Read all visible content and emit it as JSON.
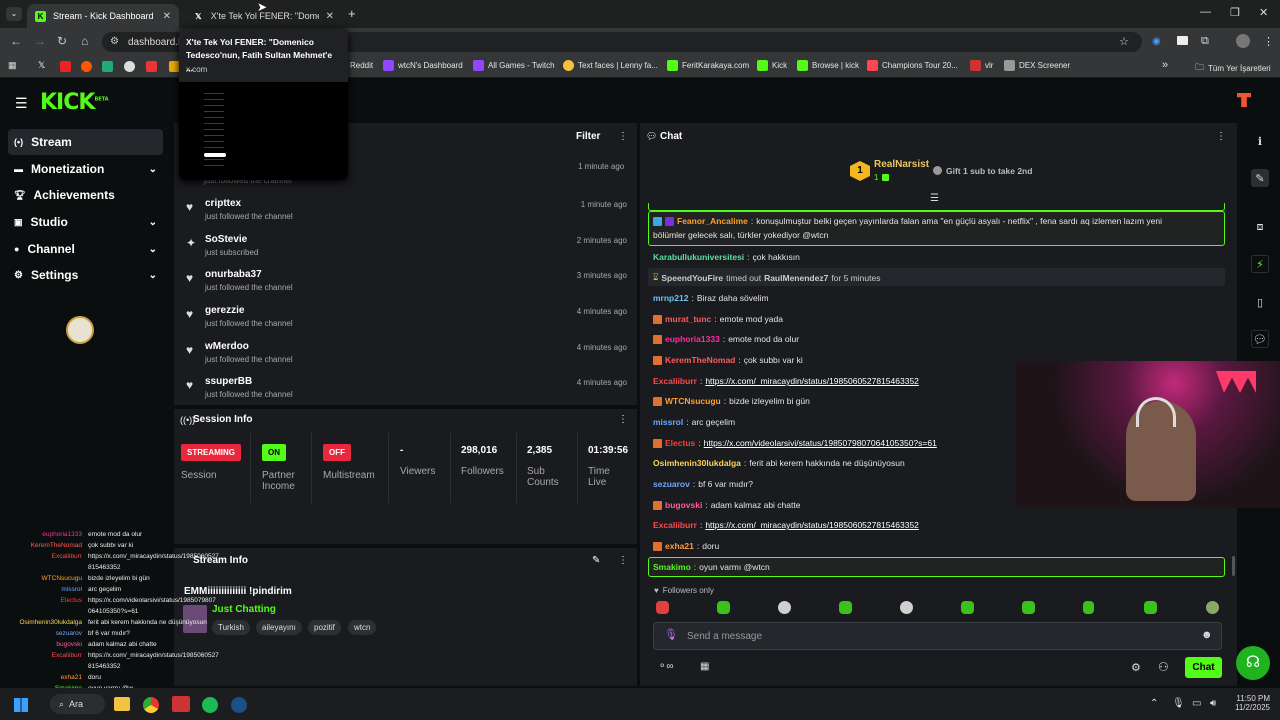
{
  "browser": {
    "tabs": [
      {
        "label": "Stream - Kick Dashboard",
        "close": "✕"
      },
      {
        "label": "X'te Tek Yol FENER: \"Domenico",
        "close": "✕"
      }
    ],
    "new_tab": "+",
    "url": "dashboard.k",
    "tooltip": {
      "title": "X'te Tek Yol FENER: \"Domenico Tedesco'nun, Fatih Sultan Mehmet'e ...",
      "site": "x.com"
    },
    "bookmarks": [
      "Reddit",
      "wtcN's Dashboard",
      "All Games - Twitch",
      "Text faces | Lenny fa...",
      "FeritKarakaya.com",
      "Kick",
      "Browse | kick",
      "Champions Tour 20...",
      "vlr",
      "DEX Screener"
    ],
    "bookmarks_more": "»",
    "all_bookmarks": "Tüm Yer İşaretleri",
    "colors": {
      "tabbar": "#1f2020",
      "toolbar": "#353637",
      "kick_green": "#53fc18"
    }
  },
  "app": {
    "logo": "KICK",
    "logo_beta": "BETA",
    "nav": [
      {
        "label": "Stream",
        "chev": ""
      },
      {
        "label": "Monetization",
        "chev": "⌄"
      },
      {
        "label": "Achievements",
        "chev": ""
      },
      {
        "label": "Studio",
        "chev": "⌄"
      },
      {
        "label": "Channel",
        "chev": "⌄"
      },
      {
        "label": "Settings",
        "chev": "⌄"
      }
    ]
  },
  "activity": {
    "filter": "Filter",
    "partial_sub": "just followed the channel",
    "events": [
      {
        "name": "cripttex",
        "action": "just followed the channel",
        "time": "1 minute ago",
        "icon": "heart-icon"
      },
      {
        "name": "SoStevie",
        "action": "just subscribed",
        "time": "2 minutes ago",
        "icon": "star-icon"
      },
      {
        "name": "onurbaba37",
        "action": "just followed the channel",
        "time": "3 minutes ago",
        "icon": "heart-icon"
      },
      {
        "name": "gerezzie",
        "action": "just followed the channel",
        "time": "4 minutes ago",
        "icon": "heart-icon"
      },
      {
        "name": "wMerdoo",
        "action": "just followed the channel",
        "time": "4 minutes ago",
        "icon": "heart-icon"
      },
      {
        "name": "ssuperBB",
        "action": "just followed the channel",
        "time": "4 minutes ago",
        "icon": "heart-icon"
      }
    ],
    "first_time": "1 minute ago"
  },
  "session": {
    "title": "Session Info",
    "items": [
      {
        "badge": "STREAMING",
        "label": "Session"
      },
      {
        "badge": "ON",
        "label": "Partner Income"
      },
      {
        "badge": "OFF",
        "label": "Multistream"
      }
    ],
    "stats": [
      {
        "value": "-",
        "label": "Viewers"
      },
      {
        "value": "298,016",
        "label": "Followers"
      },
      {
        "value": "2,385",
        "label": "Sub Counts"
      },
      {
        "value": "01:39:56",
        "label": "Time Live"
      }
    ]
  },
  "stream_info": {
    "title": "Stream Info",
    "stream_title": "EMMiiiiiiiiiiiiii !pindirim",
    "category": "Just Chatting",
    "tags": [
      "Turkish",
      "aileyayını",
      "pozitif",
      "wtcn"
    ]
  },
  "chat": {
    "title": "Chat",
    "leader": {
      "rank": "1",
      "name": "RealNarsist",
      "count": "1"
    },
    "gift_prompt": "Gift 1 sub to take 2nd",
    "messages": [
      {
        "user": "Feanor_Ancalime",
        "text": "konuşulmuştur belki geçen yayınlarda falan ama \"en güçlü asyalı - netflix\" , fena sardı aq izlemen lazım yeni",
        "text2": "bölümler gelecek salı, türkler yokediyor @wtcn",
        "color": "#53fc18"
      },
      {
        "user": "Karabullukuniversitesi",
        "text": "çok hakkısın",
        "color": "#5be0a0"
      },
      {
        "system": "SpeendYouFire",
        "text": "timed out",
        "target": "RaulMenendez7",
        "tail": "for 5 minutes"
      },
      {
        "user": "mrnp212",
        "text": "Biraz daha sövelim",
        "color": "#6fc2f0"
      },
      {
        "user": "murat_tunc",
        "text": "emote mod yada",
        "color": "#ff5b5b"
      },
      {
        "user": "euphoria1333",
        "text": "emote mod da olur",
        "color": "#ff2ea0"
      },
      {
        "user": "KeremTheNomad",
        "text": "çok subbı var ki",
        "color": "#ff5b5b"
      },
      {
        "user": "Excaliiburr",
        "text": "https://x.com/_miracaydin/status/1985060527815463352",
        "color": "#ff4a4a",
        "link": true
      },
      {
        "user": "WTCNsucugu",
        "text": "bizde izleyelim bi gün",
        "color": "#ffa030"
      },
      {
        "user": "missrol",
        "text": "arc geçelim",
        "color": "#6aa8ff"
      },
      {
        "user": "Electus",
        "text": "https://x.com/videolarsivi/status/1985079807064105350?s=61",
        "color": "#ff3c3c",
        "link": true
      },
      {
        "user": "Osimhenin30lukdalga",
        "text": "ferit abi kerem hakkında ne düşünüyosun",
        "color": "#ffd25a"
      },
      {
        "user": "sezuarov",
        "text": "bf 6 var mıdır?",
        "color": "#6aa8ff"
      },
      {
        "user": "bugovski",
        "text": "adam kalmaz abi chatte",
        "color": "#ff5b9c"
      },
      {
        "user": "Excaliiburr",
        "text": "https://x.com/_miracaydin/status/1985060527815463352",
        "color": "#ff4a4a",
        "link": true
      },
      {
        "user": "exha21",
        "text": "doru",
        "color": "#ff9a3c"
      },
      {
        "user": "Smakimo",
        "text": "oyun varmı @wtcn",
        "color": "#53fc18"
      }
    ],
    "followers_only": "Followers only",
    "placeholder": "Send a message",
    "send": "Chat"
  },
  "overlay": [
    {
      "n": "euphoria1333",
      "t": "emote mod da olur"
    },
    {
      "n": "KeremTheNomad",
      "t": "çok subbı var ki"
    },
    {
      "n": "Excaliiburr",
      "t": "https://x.com/_miracaydin/status/1985060527"
    },
    {
      "n": "",
      "t": "815463352"
    },
    {
      "n": "WTCNsucugu",
      "t": "bizde izleyelim bi gün"
    },
    {
      "n": "missrol",
      "t": "arc geçelim"
    },
    {
      "n": "Electus",
      "t": "https://x.com/videolarsivi/status/1985079807"
    },
    {
      "n": "",
      "t": "064105350?s=61"
    },
    {
      "n": "Osimhenin30lukdalga",
      "t": "ferit abi kerem hakkında ne düşünüyosun"
    },
    {
      "n": "sezuarov",
      "t": "bf 6 var mıdır?"
    },
    {
      "n": "bugovski",
      "t": "adam kalmaz abi chatte"
    },
    {
      "n": "Excaliiburr",
      "t": "https://x.com/_miracaydin/status/1985060527"
    },
    {
      "n": "",
      "t": "815463352"
    },
    {
      "n": "exha21",
      "t": "doru"
    },
    {
      "n": "Smakimo",
      "t": "oyun varmı @w"
    }
  ],
  "taskbar": {
    "search": "Ara",
    "time": "11:50 PM",
    "date": "11/2/2025"
  }
}
